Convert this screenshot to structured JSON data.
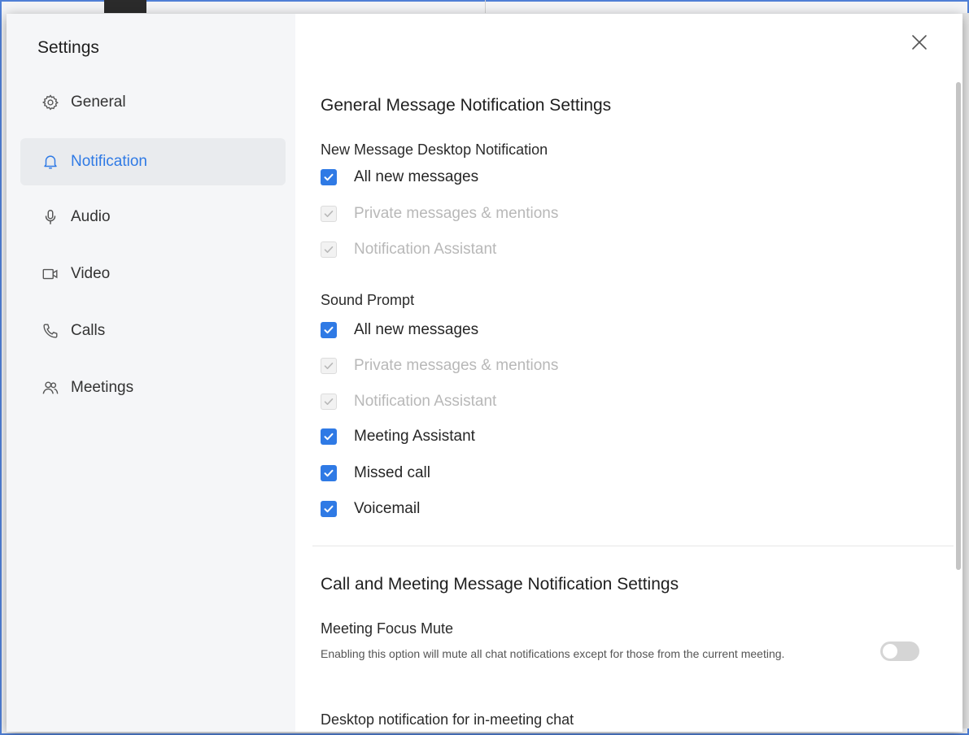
{
  "sidebar": {
    "title": "Settings",
    "items": [
      {
        "label": "General",
        "icon": "gear-icon",
        "active": false
      },
      {
        "label": "Notification",
        "icon": "bell-icon",
        "active": true
      },
      {
        "label": "Audio",
        "icon": "microphone-icon",
        "active": false
      },
      {
        "label": "Video",
        "icon": "camera-icon",
        "active": false
      },
      {
        "label": "Calls",
        "icon": "phone-icon",
        "active": false
      },
      {
        "label": "Meetings",
        "icon": "people-icon",
        "active": false
      }
    ]
  },
  "colors": {
    "accent": "#2f7ae5",
    "disabled_text": "#b8b8b8"
  },
  "content": {
    "general_section": {
      "title": "General Message Notification Settings",
      "desktop": {
        "label": "New Message Desktop Notification",
        "options": [
          {
            "label": "All new messages",
            "checked": true,
            "disabled": false
          },
          {
            "label": "Private messages & mentions",
            "checked": true,
            "disabled": true
          },
          {
            "label": "Notification Assistant",
            "checked": true,
            "disabled": true
          }
        ]
      },
      "sound": {
        "label": "Sound Prompt",
        "options": [
          {
            "label": "All new messages",
            "checked": true,
            "disabled": false
          },
          {
            "label": "Private messages & mentions",
            "checked": true,
            "disabled": true
          },
          {
            "label": "Notification Assistant",
            "checked": true,
            "disabled": true
          },
          {
            "label": "Meeting Assistant",
            "checked": true,
            "disabled": false
          },
          {
            "label": "Missed call",
            "checked": true,
            "disabled": false
          },
          {
            "label": "Voicemail",
            "checked": true,
            "disabled": false
          }
        ]
      }
    },
    "call_section": {
      "title": "Call and Meeting Message Notification Settings",
      "focus_mute": {
        "label": "Meeting Focus Mute",
        "description": "Enabling this option will mute all chat notifications except for those from the current meeting.",
        "enabled": false
      },
      "in_meeting_label": "Desktop notification for in-meeting chat"
    }
  }
}
